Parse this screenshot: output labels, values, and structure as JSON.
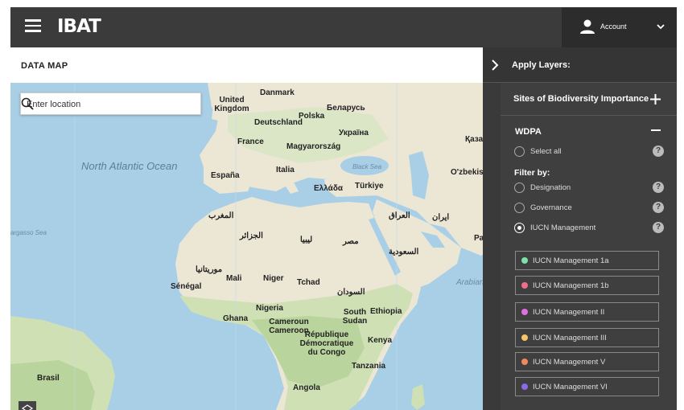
{
  "header": {
    "logo": "IBAT",
    "account_label": "Account"
  },
  "map": {
    "title": "DATA MAP",
    "search_placeholder": "Enter location",
    "labels": {
      "north_atlantic_ocean": "North Atlantic Ocean",
      "arabian_sea": "Arabian Sea",
      "sargasso_sea": "argasso Sea",
      "black_sea": "Black Sea",
      "united_kingdom": "United Kingdom",
      "danmark": "Danmark",
      "deutschland": "Deutschland",
      "polska": "Polska",
      "belarus": "Беларусь",
      "ukraina": "Україна",
      "france": "France",
      "magyarorszag": "Magyarország",
      "espana": "España",
      "italia": "Italia",
      "ellada": "Ελλάδα",
      "turkiye": "Türkiye",
      "kazakhstan": "Қазақста",
      "ozbekiston": "O'zbekiston",
      "pakistan": "Pakista",
      "maghreb": "المغرب",
      "algeria": "الجزائر",
      "libya": "ليبيا",
      "egypt": "مصر",
      "iraq": "العراق",
      "iran": "ایران",
      "saudi": "السعودية",
      "mauritania": "موريتانيا",
      "mali": "Mali",
      "niger": "Niger",
      "tchad": "Tchad",
      "sudan": "السودان",
      "senegal": "Sénégal",
      "nigeria": "Nigeria",
      "ghana": "Ghana",
      "cameroun": "Cameroun Cameroon",
      "south_sudan": "South Sudan",
      "ethiopia": "Ethiopia",
      "rdc": "République Démocratique du Congo",
      "kenya": "Kenya",
      "tanzania": "Tanzania",
      "angola": "Angola",
      "brasil": "Brasil"
    }
  },
  "panel": {
    "apply_label": "Apply Layers:",
    "sbi_label": "Sites of Biodiversity Importance",
    "wdpa_label": "WDPA",
    "select_all_label": "Select all",
    "filter_by_label": "Filter by:",
    "filters": [
      {
        "label": "Designation",
        "selected": false
      },
      {
        "label": "Governance",
        "selected": false
      },
      {
        "label": "IUCN Management",
        "selected": true
      }
    ],
    "categories": [
      {
        "label": "IUCN Management 1a",
        "color": "#7fe0a8"
      },
      {
        "label": "IUCN Management 1b",
        "color": "#ef6f8a"
      },
      {
        "label": "IUCN Management II",
        "color": "#e06fe0"
      },
      {
        "label": "IUCN Management III",
        "color": "#f4c46a"
      },
      {
        "label": "IUCN Management V",
        "color": "#f08a5a"
      },
      {
        "label": "IUCN Management VI",
        "color": "#8a6ae6"
      }
    ]
  }
}
